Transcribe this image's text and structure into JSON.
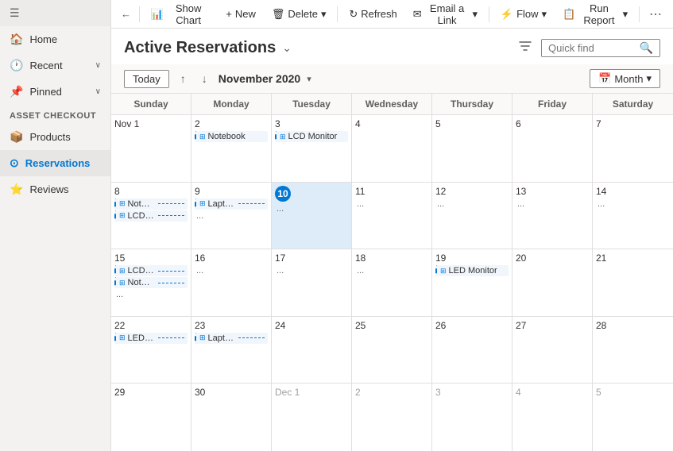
{
  "sidebar": {
    "hamburger_icon": "☰",
    "items": [
      {
        "id": "home",
        "label": "Home",
        "icon": "🏠",
        "active": false
      },
      {
        "id": "recent",
        "label": "Recent",
        "icon": "🕐",
        "active": false,
        "expand": true
      },
      {
        "id": "pinned",
        "label": "Pinned",
        "icon": "📌",
        "active": false,
        "expand": true
      }
    ],
    "group_label": "Asset Checkout",
    "group_items": [
      {
        "id": "products",
        "label": "Products",
        "icon": "📦",
        "active": false
      },
      {
        "id": "reservations",
        "label": "Reservations",
        "icon": "⊙",
        "active": true
      },
      {
        "id": "reviews",
        "label": "Reviews",
        "icon": "⭐",
        "active": false
      }
    ]
  },
  "toolbar": {
    "back_icon": "←",
    "show_chart_icon": "📊",
    "show_chart_label": "Show Chart",
    "new_icon": "+",
    "new_label": "New",
    "delete_icon": "🗑",
    "delete_label": "Delete",
    "delete_chevron": "▾",
    "refresh_icon": "↻",
    "refresh_label": "Refresh",
    "email_icon": "✉",
    "email_label": "Email a Link",
    "email_chevron": "▾",
    "flow_icon": "⚡",
    "flow_label": "Flow",
    "flow_chevron": "▾",
    "report_icon": "📋",
    "report_label": "Run Report",
    "report_chevron": "▾",
    "more_icon": "⋯"
  },
  "page_header": {
    "title": "Active Reservations",
    "chevron": "⌄",
    "filter_icon": "⊟",
    "search_placeholder": "Quick find",
    "search_icon": "🔍"
  },
  "calendar_nav": {
    "today_label": "Today",
    "prev_icon": "↑",
    "next_icon": "↓",
    "month_label": "November 2020",
    "month_chevron": "▾",
    "view_icon": "📅",
    "view_label": "Month",
    "view_chevron": "▾"
  },
  "calendar": {
    "headers": [
      "Sunday",
      "Monday",
      "Tuesday",
      "Wednesday",
      "Thursday",
      "Friday",
      "Saturday"
    ],
    "weeks": [
      {
        "days": [
          {
            "num": "Nov 1",
            "other": false,
            "today": false,
            "events": []
          },
          {
            "num": "2",
            "other": false,
            "today": false,
            "events": [
              {
                "label": "Notebook",
                "dashed": true
              }
            ]
          },
          {
            "num": "3",
            "other": false,
            "today": false,
            "events": [
              {
                "label": "LCD Monitor",
                "dashed": true
              }
            ]
          },
          {
            "num": "4",
            "other": false,
            "today": false,
            "events": []
          },
          {
            "num": "5",
            "other": false,
            "today": false,
            "events": []
          },
          {
            "num": "6",
            "other": false,
            "today": false,
            "events": []
          },
          {
            "num": "7",
            "other": false,
            "today": false,
            "events": []
          }
        ]
      },
      {
        "days": [
          {
            "num": "8",
            "other": false,
            "today": false,
            "events": [
              {
                "label": "Notebook",
                "dashed": true
              },
              {
                "label": "LCD Monitor",
                "dashed": true
              }
            ]
          },
          {
            "num": "9",
            "other": false,
            "today": false,
            "events": [
              {
                "label": "Laptop",
                "dashed": true
              }
            ],
            "more": "..."
          },
          {
            "num": "10",
            "other": false,
            "today": true,
            "events": [],
            "more": "..."
          },
          {
            "num": "11",
            "other": false,
            "today": false,
            "events": [],
            "more": "..."
          },
          {
            "num": "12",
            "other": false,
            "today": false,
            "events": [],
            "more": "..."
          },
          {
            "num": "13",
            "other": false,
            "today": false,
            "events": [],
            "more": "..."
          },
          {
            "num": "14",
            "other": false,
            "today": false,
            "events": [],
            "more": "..."
          }
        ]
      },
      {
        "days": [
          {
            "num": "15",
            "other": false,
            "today": false,
            "events": [
              {
                "label": "LCD Monitor",
                "dashed": true
              },
              {
                "label": "Notebook",
                "dashed": true
              }
            ],
            "more": "..."
          },
          {
            "num": "16",
            "other": false,
            "today": false,
            "events": [],
            "more": "..."
          },
          {
            "num": "17",
            "other": false,
            "today": false,
            "events": [],
            "more": "..."
          },
          {
            "num": "18",
            "other": false,
            "today": false,
            "events": [],
            "more": "..."
          },
          {
            "num": "19",
            "other": false,
            "today": false,
            "events": [
              {
                "label": "LED Monitor",
                "dashed": true
              }
            ]
          },
          {
            "num": "20",
            "other": false,
            "today": false,
            "events": []
          },
          {
            "num": "21",
            "other": false,
            "today": false,
            "events": []
          }
        ]
      },
      {
        "days": [
          {
            "num": "22",
            "other": false,
            "today": false,
            "events": [
              {
                "label": "LED Monitor",
                "dashed": true
              }
            ]
          },
          {
            "num": "23",
            "other": false,
            "today": false,
            "events": [
              {
                "label": "Laptop",
                "dashed": true
              }
            ]
          },
          {
            "num": "24",
            "other": false,
            "today": false,
            "events": []
          },
          {
            "num": "25",
            "other": false,
            "today": false,
            "events": []
          },
          {
            "num": "26",
            "other": false,
            "today": false,
            "events": []
          },
          {
            "num": "27",
            "other": false,
            "today": false,
            "events": []
          },
          {
            "num": "28",
            "other": false,
            "today": false,
            "events": []
          }
        ]
      },
      {
        "days": [
          {
            "num": "29",
            "other": false,
            "today": false,
            "events": []
          },
          {
            "num": "30",
            "other": false,
            "today": false,
            "events": []
          },
          {
            "num": "Dec 1",
            "other": true,
            "today": false,
            "events": []
          },
          {
            "num": "2",
            "other": true,
            "today": false,
            "events": []
          },
          {
            "num": "3",
            "other": true,
            "today": false,
            "events": []
          },
          {
            "num": "4",
            "other": true,
            "today": false,
            "events": []
          },
          {
            "num": "5",
            "other": true,
            "today": false,
            "events": []
          }
        ]
      }
    ]
  }
}
